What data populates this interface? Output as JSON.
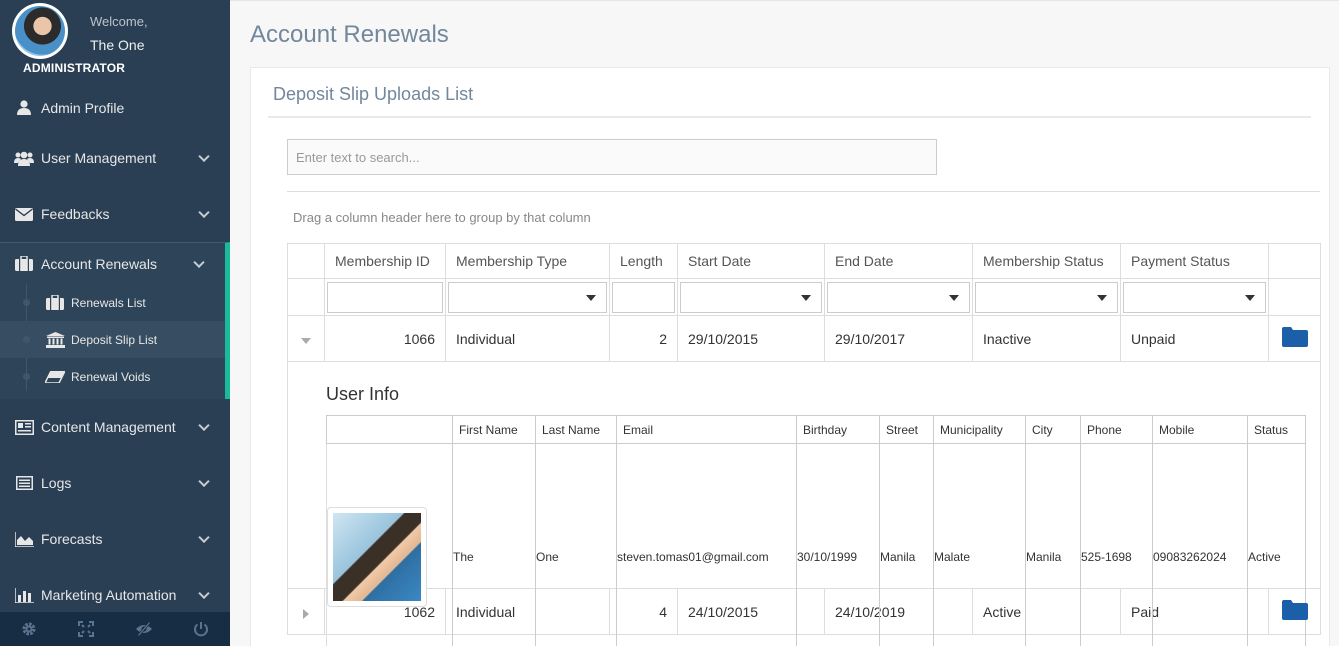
{
  "sidebar": {
    "welcome": "Welcome,",
    "user_name": "The One",
    "role": "ADMINISTRATOR",
    "menu": {
      "admin_profile": "Admin Profile",
      "user_management": "User Management",
      "feedbacks": "Feedbacks",
      "account_renewals": "Account Renewals",
      "content_management": "Content Management",
      "logs": "Logs",
      "forecasts": "Forecasts",
      "marketing_automation": "Marketing Automation"
    },
    "submenu": {
      "renewals_list": "Renewals List",
      "deposit_slip_list": "Deposit Slip List",
      "renewal_voids": "Renewal Voids"
    },
    "accent_color": "#1abb9c",
    "footer_icons": [
      "gear-icon",
      "fullscreen-icon",
      "eye-slash-icon",
      "power-icon"
    ]
  },
  "main": {
    "page_title": "Account Renewals",
    "panel_title": "Deposit Slip Uploads List",
    "search_placeholder": "Enter text to search...",
    "group_hint": "Drag a column header here to group by that column",
    "columns": [
      "Membership ID",
      "Membership Type",
      "Length",
      "Start Date",
      "End Date",
      "Membership Status",
      "Payment Status"
    ],
    "rows": [
      {
        "id": "1066",
        "type": "Individual",
        "length": "2",
        "start": "29/10/2015",
        "end": "29/10/2017",
        "status": "Inactive",
        "payment": "Unpaid",
        "expanded": true
      },
      {
        "id": "1062",
        "type": "Individual",
        "length": "4",
        "start": "24/10/2015",
        "end": "24/10/2019",
        "status": "Active",
        "payment": "Paid",
        "expanded": false
      }
    ],
    "detail": {
      "title": "User Info",
      "columns": [
        "First Name",
        "Last Name",
        "Email",
        "Birthday",
        "Street",
        "Municipality",
        "City",
        "Phone",
        "Mobile",
        "Status"
      ],
      "values": [
        "The",
        "One",
        "steven.tomas01@gmail.com",
        "30/10/1999",
        "Manila",
        "Malate",
        "Manila",
        "525-1698",
        "09083262024",
        "Active"
      ]
    },
    "folder_color": "#1a5fa8"
  }
}
